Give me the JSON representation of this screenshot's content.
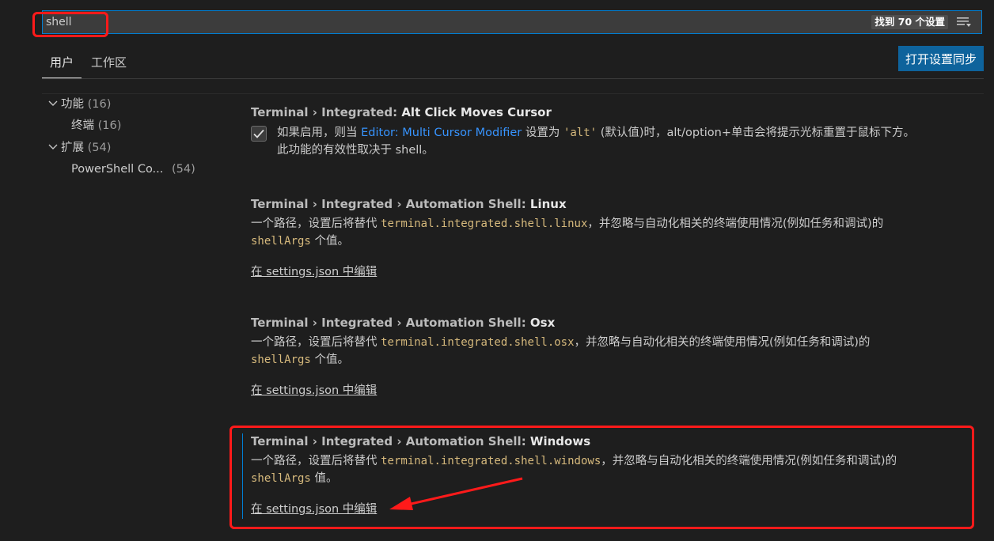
{
  "search": {
    "value": "shell",
    "count_text": "找到 70 个设置",
    "filter_icon": "list-filter-icon"
  },
  "tabs": [
    {
      "label": "用户",
      "active": true
    },
    {
      "label": "工作区",
      "active": false
    }
  ],
  "sync_button": "打开设置同步",
  "toc": [
    {
      "label": "功能",
      "count": "(16)",
      "expanded": true
    },
    {
      "label": "终端",
      "count": "(16)"
    },
    {
      "label": "扩展",
      "count": "(54)",
      "expanded": true
    },
    {
      "label": "PowerShell Co...",
      "count": "(54)"
    }
  ],
  "settings": [
    {
      "category": "Terminal › Integrated: ",
      "name": "Alt Click Moves Cursor",
      "checked": true,
      "desc_1": "如果启用，则当 ",
      "desc_link": "Editor: Multi Cursor Modifier",
      "desc_2": " 设置为 ",
      "desc_code": "'alt'",
      "desc_3": " (默认值)时，alt/option+单击会将提示光标重置于鼠标下方。",
      "desc_line2": "此功能的有效性取决于 shell。"
    },
    {
      "category": "Terminal › Integrated › Automation Shell: ",
      "name": "Linux",
      "desc_1": "一个路径，设置后将替代 ",
      "desc_code": "terminal.integrated.shell.linux",
      "desc_2": "，并忽略与自动化相关的终端使用情况(例如任务和调试)的",
      "desc_code2": "shellArgs",
      "desc_3": " 个值。",
      "edit_link": "在 settings.json 中编辑"
    },
    {
      "category": "Terminal › Integrated › Automation Shell: ",
      "name": "Osx",
      "desc_1": "一个路径，设置后将替代 ",
      "desc_code": "terminal.integrated.shell.osx",
      "desc_2": "，并忽略与自动化相关的终端使用情况(例如任务和调试)的",
      "desc_code2": "shellArgs",
      "desc_3": " 个值。",
      "edit_link": "在 settings.json 中编辑"
    },
    {
      "category": "Terminal › Integrated › Automation Shell: ",
      "name": "Windows",
      "desc_1": "一个路径，设置后将替代 ",
      "desc_code": "terminal.integrated.shell.windows",
      "desc_2": "，并忽略与自动化相关的终端使用情况(例如任务和调试)的",
      "desc_code2": "shellArgs",
      "desc_3": " 值。",
      "edit_link": "在 settings.json 中编辑"
    }
  ],
  "colors": {
    "background": "#1e1e1e",
    "accent": "#007fd4",
    "button": "#0e639c",
    "annotation": "#ff1a1a",
    "code": "#d7ba7d",
    "link": "#3794ff"
  }
}
